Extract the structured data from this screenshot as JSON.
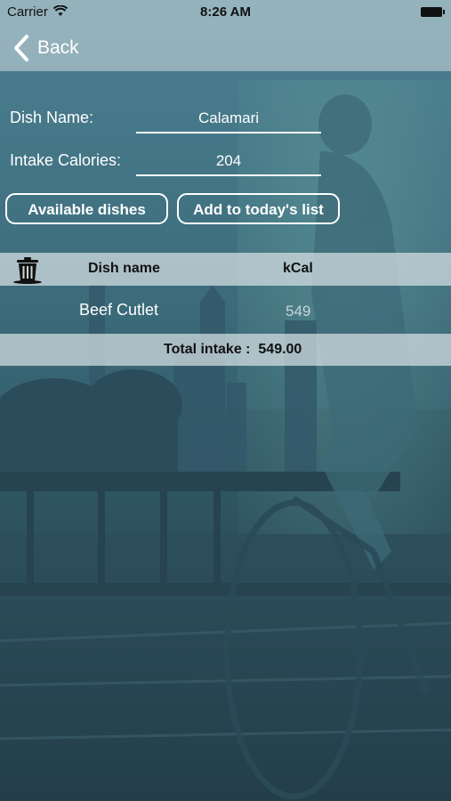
{
  "status_bar": {
    "carrier": "Carrier",
    "time": "8:26 AM"
  },
  "nav": {
    "back_label": "Back"
  },
  "form": {
    "dish_name_label": "Dish Name:",
    "dish_name_value": "Calamari",
    "intake_calories_label": "Intake Calories:",
    "intake_calories_value": "204"
  },
  "buttons": {
    "available_dishes": "Available dishes",
    "add_to_list": "Add to today's list"
  },
  "table": {
    "columns": [
      "Dish name",
      "kCal"
    ],
    "rows": [
      {
        "dish": "Beef Cutlet",
        "kcal": "549"
      }
    ],
    "total_label": "Total intake :",
    "total_value": "549.00"
  },
  "icons": {
    "trash": "trash-icon",
    "back": "chevron-left-icon",
    "wifi": "wifi-icon",
    "battery": "battery-icon"
  }
}
